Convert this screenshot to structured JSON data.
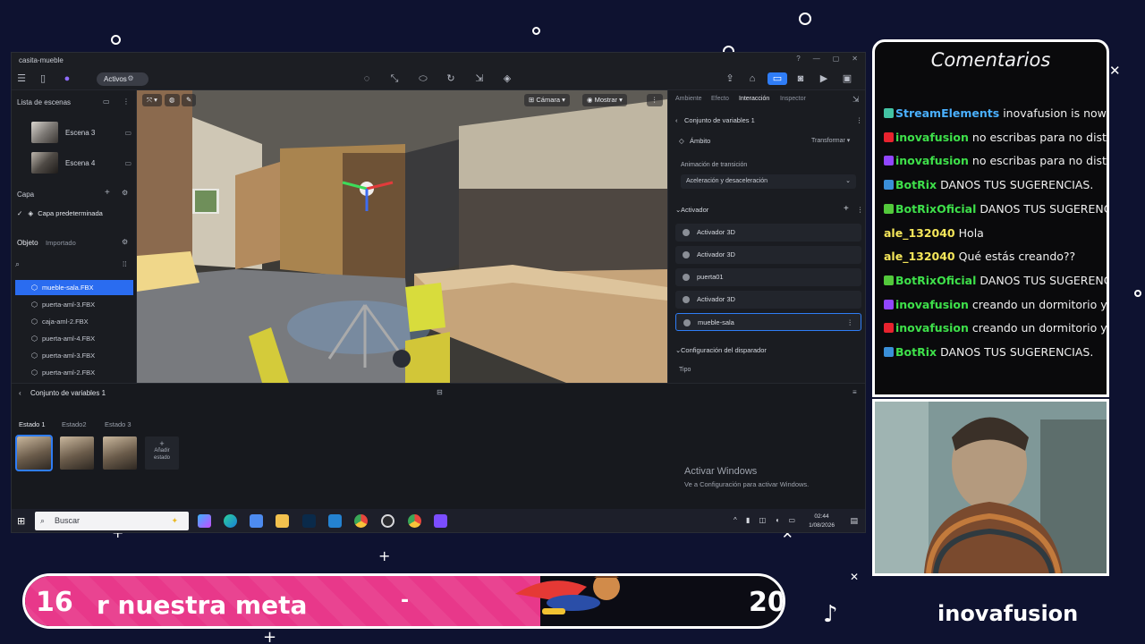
{
  "window": {
    "title": "casita-mueble"
  },
  "toolbar": {
    "activos_label": "Activos"
  },
  "left_panel": {
    "scenes_header": "Lista de escenas",
    "scenes": [
      {
        "label": "Escena 3"
      },
      {
        "label": "Escena 4"
      }
    ],
    "layer_header": "Capa",
    "default_layer": "Capa predeterminada",
    "tabs": {
      "object": "Objeto",
      "imported": "Importado"
    },
    "objects": [
      {
        "label": "mueble-sala.FBX",
        "selected": true
      },
      {
        "label": "puerta-aml-3.FBX"
      },
      {
        "label": "caja-aml-2.FBX"
      },
      {
        "label": "puerta-aml-4.FBX"
      },
      {
        "label": "puerta-aml-3.FBX"
      },
      {
        "label": "puerta-aml-2.FBX"
      }
    ]
  },
  "viewport": {
    "camera_label": "Cámara",
    "show_label": "Mostrar"
  },
  "right_panel": {
    "tabs": [
      "Ambiente",
      "Efecto",
      "Interacción",
      "Inspector"
    ],
    "active_tab": "Interacción",
    "variable_set": "Conjunto de variables 1",
    "scope_label": "Ámbito",
    "scope_value": "Transformar",
    "transition_label": "Animación de transición",
    "transition_value": "Aceleración y desaceleración",
    "activator_header": "Activador",
    "activators": [
      {
        "label": "Activador 3D"
      },
      {
        "label": "Activador 3D"
      },
      {
        "label": "puerta01"
      },
      {
        "label": "Activador 3D"
      },
      {
        "label": "mueble-sala",
        "selected": true
      }
    ],
    "trigger_config": "Configuración del disparador",
    "type_label": "Tipo"
  },
  "bottom_panel": {
    "variable_set": "Conjunto de variables 1",
    "states": [
      "Estado 1",
      "Estado2",
      "Estado 3"
    ],
    "add_state": "Añadir estado",
    "activate_windows_title": "Activar Windows",
    "activate_windows_sub": "Ve a Configuración para activar Windows."
  },
  "taskbar": {
    "search_placeholder": "Buscar",
    "time": "02:44",
    "date": "1/08/2026"
  },
  "chat": {
    "title": "Comentarios",
    "messages": [
      {
        "user": "StreamElements",
        "text": "inovafusion is now live! UNA ANIMACION",
        "user_color": "#4ab0ff",
        "badge_color": "#43c3a3"
      },
      {
        "user": "inovafusion",
        "text": "no escribas para no distraer",
        "user_color": "#3ee04a",
        "badge_color": "#e8232e"
      },
      {
        "user": "inovafusion",
        "text": "no escribas para no distraer",
        "user_color": "#3ee04a",
        "badge_color": "#9146ff"
      },
      {
        "user": "BotRix",
        "text": "DANOS TUS SUGERENCIAS.",
        "user_color": "#3ee04a",
        "badge_color": "#3a8fd8"
      },
      {
        "user": "BotRixOficial",
        "text": "DANOS TUS SUGERENCIAS.",
        "user_color": "#3ee04a",
        "badge_color": "#53c83b"
      },
      {
        "user": "ale_132040",
        "text": "Hola",
        "user_color": "#f5e65a",
        "badge_color": ""
      },
      {
        "user": "ale_132040",
        "text": "Qué estás creando??",
        "user_color": "#f5e65a",
        "badge_color": ""
      },
      {
        "user": "BotRixOficial",
        "text": "DANOS TUS SUGERENCIAS.",
        "user_color": "#3ee04a",
        "badge_color": "#53c83b"
      },
      {
        "user": "inovafusion",
        "text": "creando un dormitorio y cocina",
        "user_color": "#3ee04a",
        "badge_color": "#9146ff"
      },
      {
        "user": "inovafusion",
        "text": "creando un dormitorio y cocina",
        "user_color": "#3ee04a",
        "badge_color": "#e8232e"
      },
      {
        "user": "BotRix",
        "text": "DANOS TUS SUGERENCIAS.",
        "user_color": "#3ee04a",
        "badge_color": "#3a8fd8"
      }
    ]
  },
  "goal": {
    "current": "16",
    "target": "20",
    "text": "r nuestra meta",
    "separator": "-",
    "progress": 0.8,
    "fill_color": "#e8388a"
  },
  "tiktok": {
    "handle": "inovafusion",
    "icon": "tiktok-icon"
  }
}
